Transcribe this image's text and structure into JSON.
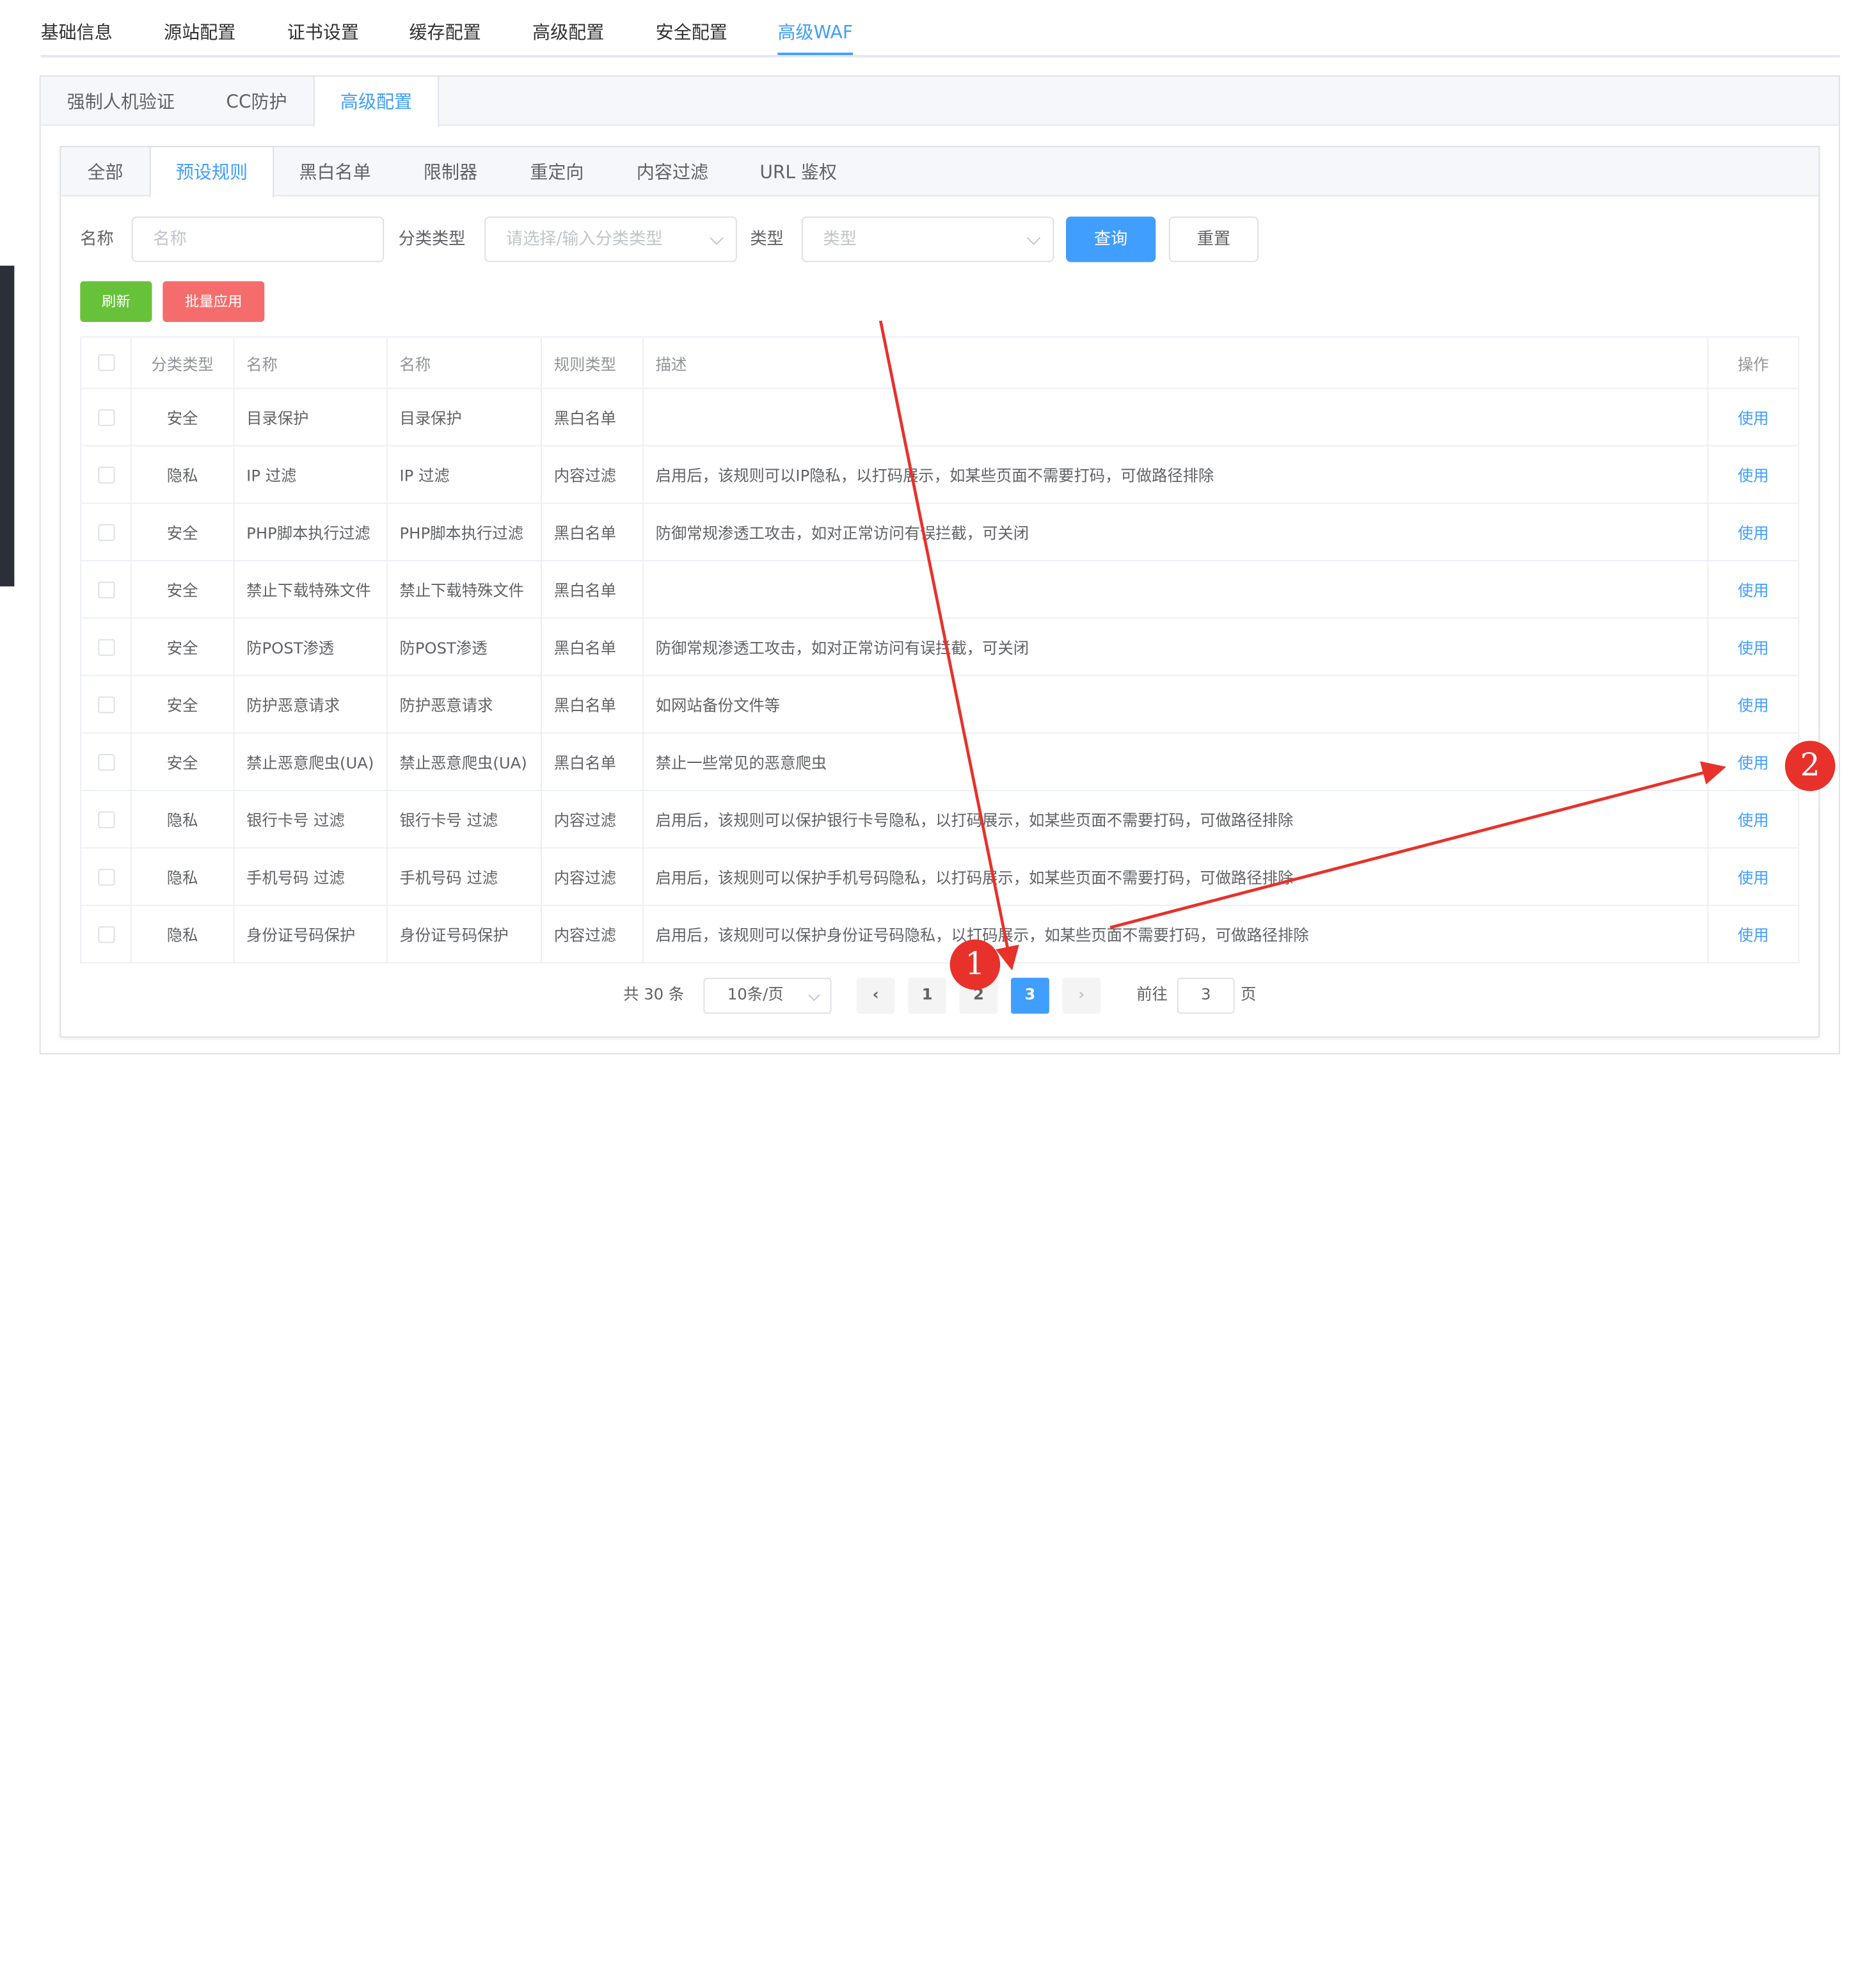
{
  "top_tabs": [
    "基础信息",
    "源站配置",
    "证书设置",
    "缓存配置",
    "高级配置",
    "安全配置",
    "高级WAF"
  ],
  "waf_tabs": [
    "强制人机验证",
    "CC防护",
    "高级配置"
  ],
  "rule_tabs": [
    "全部",
    "预设规则",
    "黑白名单",
    "限制器",
    "重定向",
    "内容过滤",
    "URL 鉴权"
  ],
  "filters": {
    "name_label": "名称",
    "name_placeholder": "名称",
    "category_label": "分类类型",
    "category_placeholder": "请选择/输入分类类型",
    "type_label": "类型",
    "type_placeholder": "类型",
    "query_label": "查询",
    "reset_label": "重置"
  },
  "actions": {
    "refresh_label": "刷新",
    "batch_apply_label": "批量应用"
  },
  "colors": {
    "primary": "#409eff",
    "success": "#67c23a",
    "danger": "#f56c6c",
    "annotation": "#e8312b"
  },
  "table": {
    "headers": [
      "",
      "分类类型",
      "名称",
      "名称",
      "规则类型",
      "描述",
      "操作"
    ],
    "rows": [
      {
        "category": "安全",
        "name": "目录保护",
        "name2": "目录保护",
        "rule_type": "黑白名单",
        "desc": "",
        "op": "使用"
      },
      {
        "category": "隐私",
        "name": "IP 过滤",
        "name2": "IP 过滤",
        "rule_type": "内容过滤",
        "desc": "启用后，该规则可以IP隐私，以打码展示，如某些页面不需要打码，可做路径排除",
        "op": "使用"
      },
      {
        "category": "安全",
        "name": "PHP脚本执行过滤",
        "name2": "PHP脚本执行过滤",
        "rule_type": "黑白名单",
        "desc": "防御常规渗透工攻击，如对正常访问有误拦截，可关闭",
        "op": "使用"
      },
      {
        "category": "安全",
        "name": "禁止下载特殊文件",
        "name2": "禁止下载特殊文件",
        "rule_type": "黑白名单",
        "desc": "",
        "op": "使用"
      },
      {
        "category": "安全",
        "name": "防POST渗透",
        "name2": "防POST渗透",
        "rule_type": "黑白名单",
        "desc": "防御常规渗透工攻击，如对正常访问有误拦截，可关闭",
        "op": "使用"
      },
      {
        "category": "安全",
        "name": "防护恶意请求",
        "name2": "防护恶意请求",
        "rule_type": "黑白名单",
        "desc": "如网站备份文件等",
        "op": "使用"
      },
      {
        "category": "安全",
        "name": "禁止恶意爬虫(UA)",
        "name2": "禁止恶意爬虫(UA)",
        "rule_type": "黑白名单",
        "desc": "禁止一些常见的恶意爬虫",
        "op": "使用"
      },
      {
        "category": "隐私",
        "name": "银行卡号 过滤",
        "name2": "银行卡号 过滤",
        "rule_type": "内容过滤",
        "desc": "启用后，该规则可以保护银行卡号隐私，以打码展示，如某些页面不需要打码，可做路径排除",
        "op": "使用"
      },
      {
        "category": "隐私",
        "name": "手机号码 过滤",
        "name2": "手机号码 过滤",
        "rule_type": "内容过滤",
        "desc": "启用后，该规则可以保护手机号码隐私，以打码展示，如某些页面不需要打码，可做路径排除",
        "op": "使用"
      },
      {
        "category": "隐私",
        "name": "身份证号码保护",
        "name2": "身份证号码保护",
        "rule_type": "内容过滤",
        "desc": "启用后，该规则可以保护身份证号码隐私，以打码展示，如某些页面不需要打码，可做路径排除",
        "op": "使用"
      }
    ]
  },
  "pagination": {
    "total_text": "共 30 条",
    "page_size": "10条/页",
    "pages": [
      "1",
      "2",
      "3"
    ],
    "current_page": "3",
    "prev_icon": "‹",
    "next_icon": "›",
    "goto_label": "前往",
    "goto_value": "3",
    "page_suffix": "页"
  },
  "annotations": {
    "marker1": "1",
    "marker2": "2"
  }
}
